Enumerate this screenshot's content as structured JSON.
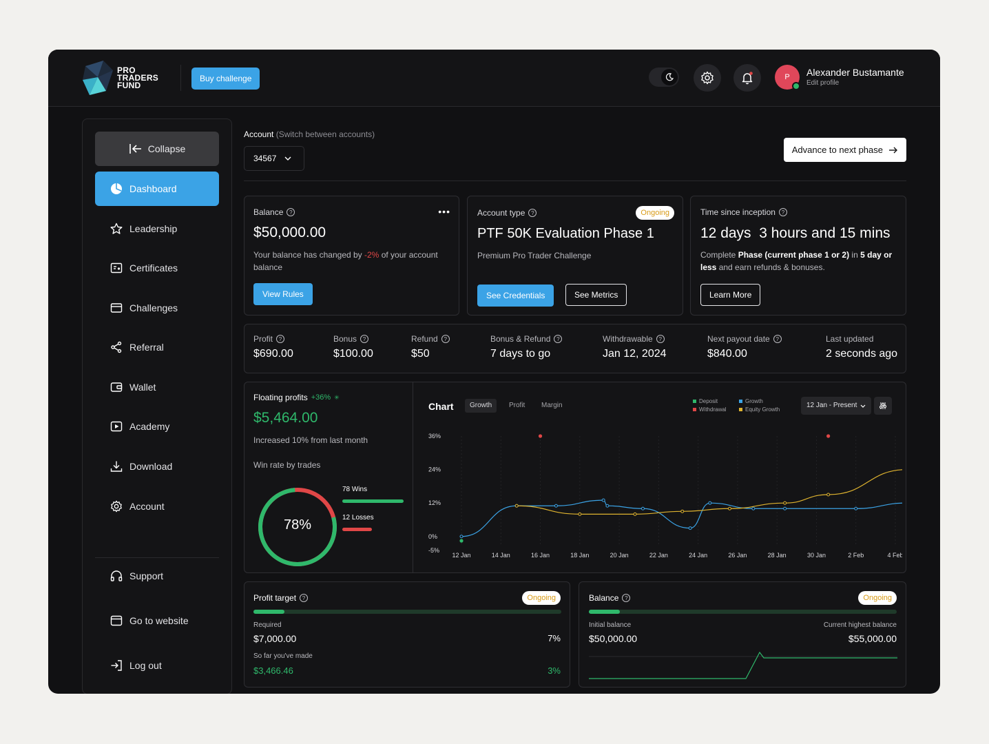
{
  "header": {
    "logo_line1": "PRO",
    "logo_line2": "TRADERS",
    "logo_line3": "FUND",
    "buy_label": "Buy challenge",
    "user_initial": "P",
    "user_name": "Alexander Bustamante",
    "edit_profile": "Edit profile"
  },
  "sidebar": {
    "collapse": "Collapse",
    "items": [
      {
        "label": "Dashboard",
        "icon": "dashboard-icon"
      },
      {
        "label": "Leadership",
        "icon": "star-icon"
      },
      {
        "label": "Certificates",
        "icon": "certificate-icon"
      },
      {
        "label": "Challenges",
        "icon": "card-icon"
      },
      {
        "label": "Referral",
        "icon": "share-icon"
      },
      {
        "label": "Wallet",
        "icon": "wallet-icon"
      },
      {
        "label": "Academy",
        "icon": "play-icon"
      },
      {
        "label": "Download",
        "icon": "download-icon"
      },
      {
        "label": "Account",
        "icon": "gear-icon"
      }
    ],
    "bottom": [
      {
        "label": "Support",
        "icon": "headphones-icon"
      },
      {
        "label": "Go to website",
        "icon": "browser-icon"
      },
      {
        "label": "Log out",
        "icon": "logout-icon"
      }
    ]
  },
  "account": {
    "label": "Account",
    "hint": "(Switch between accounts)",
    "selected": "34567",
    "advance": "Advance to next phase"
  },
  "cards": {
    "balance": {
      "title": "Balance",
      "value": "$50,000.00",
      "desc_pre": "Your balance has changed by ",
      "desc_pct": "-2%",
      "desc_post": " of your account balance",
      "button": "View Rules"
    },
    "account_type": {
      "title": "Account type",
      "badge": "Ongoing",
      "value": "PTF 50K Evaluation Phase 1",
      "sub": "Premium Pro Trader Challenge",
      "btn1": "See Credentials",
      "btn2": "See Metrics"
    },
    "inception": {
      "title": "Time since inception",
      "value": "12 days  3 hours and 15 mins",
      "desc_pre": "Complete ",
      "desc_b1": "Phase (current phase 1 or 2)",
      "desc_mid": " in ",
      "desc_b2": "5 day or less",
      "desc_post": " and earn refunds & bonuses.",
      "button": "Learn More"
    }
  },
  "stats": [
    {
      "label": "Profit",
      "value": "$690.00",
      "color": "#2fb86b",
      "help": true
    },
    {
      "label": "Bonus",
      "value": "$100.00",
      "color": "#2fb86b",
      "help": true
    },
    {
      "label": "Refund",
      "value": "$50",
      "color": "#2fb86b",
      "help": true
    },
    {
      "label": "Bonus & Refund",
      "value": "7 days to go",
      "color": "#ffffff",
      "help": true
    },
    {
      "label": "Withdrawable",
      "value": "Jan 12, 2024",
      "color": "#ffffff",
      "help": true
    },
    {
      "label": "Next payout date",
      "value": "$840.00",
      "color": "#2fb86b",
      "help": true
    },
    {
      "label": "Last updated",
      "value": "2 seconds ago",
      "color": "#ffffff",
      "help": false
    }
  ],
  "floating": {
    "title": "Floating profits",
    "pct": "+36%",
    "value": "$5,464.00",
    "sub": "Increased 10% from last month",
    "winrate_label": "Win rate by trades",
    "winrate_pct": "78%",
    "wins": "78 Wins",
    "losses": "12 Losses",
    "win_fraction": 0.78
  },
  "chart": {
    "title": "Chart",
    "tabs": [
      "Growth",
      "Profit",
      "Margin"
    ],
    "legend": [
      {
        "name": "Deposit",
        "color": "#2fb86b"
      },
      {
        "name": "Withdrawal",
        "color": "#e04747"
      },
      {
        "name": "Growth",
        "color": "#3ba3e6"
      },
      {
        "name": "Equity Growth",
        "color": "#e0b42f"
      }
    ],
    "range": "12 Jan - Present"
  },
  "chart_data": {
    "type": "line",
    "x": [
      "12 Jan",
      "14 Jan",
      "16 Jan",
      "18 Jan",
      "20 Jan",
      "22 Jan",
      "24 Jan",
      "26 Jan",
      "28 Jan",
      "30 Jan",
      "2 Feb",
      "4 Feb"
    ],
    "yticks": [
      "36%",
      "24%",
      "12%",
      "0%",
      "-5%"
    ],
    "ylim": [
      -5,
      36
    ],
    "series": [
      {
        "name": "Growth",
        "points": [
          [
            0,
            0
          ],
          [
            1.4,
            11
          ],
          [
            2.4,
            11
          ],
          [
            3.7,
            11
          ],
          [
            3.6,
            13
          ],
          [
            4.6,
            10
          ],
          [
            5.8,
            3
          ],
          [
            6.3,
            12
          ],
          [
            7.4,
            10
          ],
          [
            8.2,
            10
          ],
          [
            10.0,
            10
          ],
          [
            11.3,
            12
          ]
        ]
      },
      {
        "name": "Equity Growth",
        "points": [
          [
            1.4,
            11
          ],
          [
            3.0,
            8
          ],
          [
            4.4,
            8
          ],
          [
            5.6,
            9
          ],
          [
            6.8,
            10
          ],
          [
            8.2,
            12
          ],
          [
            9.3,
            15
          ],
          [
            11.3,
            24
          ]
        ]
      }
    ],
    "withdrawal_points": [
      [
        2.0,
        36
      ],
      [
        9.3,
        36
      ]
    ],
    "deposit_points": [
      [
        0,
        -5
      ]
    ]
  },
  "profit_target": {
    "title": "Profit target",
    "badge": "Ongoing",
    "progress": 0.1,
    "required_label": "Required",
    "required_value": "$7,000.00",
    "required_pct": "7%",
    "made_label": "So far you've made",
    "made_value": "$3,466.46",
    "made_pct": "3%"
  },
  "balance_card": {
    "title": "Balance",
    "badge": "Ongoing",
    "progress": 0.1,
    "initial_label": "Initial balance",
    "initial_value": "$50,000.00",
    "highest_label": "Current highest balance",
    "highest_value": "$55,000.00"
  }
}
